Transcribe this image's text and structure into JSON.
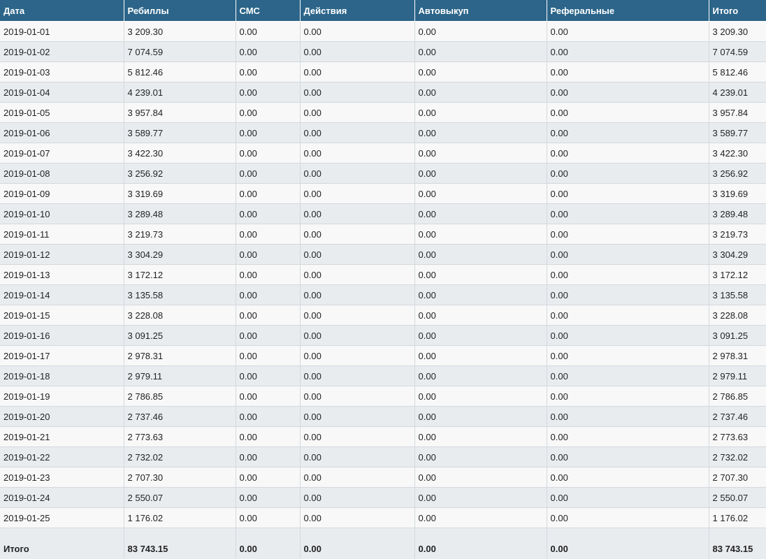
{
  "table": {
    "headers": [
      "Дата",
      "Ребиллы",
      "СМС",
      "Действия",
      "Автовыкуп",
      "Реферальные",
      "Итого"
    ],
    "rows": [
      [
        "2019-01-01",
        "3 209.30",
        "0.00",
        "0.00",
        "0.00",
        "0.00",
        "3 209.30"
      ],
      [
        "2019-01-02",
        "7 074.59",
        "0.00",
        "0.00",
        "0.00",
        "0.00",
        "7 074.59"
      ],
      [
        "2019-01-03",
        "5 812.46",
        "0.00",
        "0.00",
        "0.00",
        "0.00",
        "5 812.46"
      ],
      [
        "2019-01-04",
        "4 239.01",
        "0.00",
        "0.00",
        "0.00",
        "0.00",
        "4 239.01"
      ],
      [
        "2019-01-05",
        "3 957.84",
        "0.00",
        "0.00",
        "0.00",
        "0.00",
        "3 957.84"
      ],
      [
        "2019-01-06",
        "3 589.77",
        "0.00",
        "0.00",
        "0.00",
        "0.00",
        "3 589.77"
      ],
      [
        "2019-01-07",
        "3 422.30",
        "0.00",
        "0.00",
        "0.00",
        "0.00",
        "3 422.30"
      ],
      [
        "2019-01-08",
        "3 256.92",
        "0.00",
        "0.00",
        "0.00",
        "0.00",
        "3 256.92"
      ],
      [
        "2019-01-09",
        "3 319.69",
        "0.00",
        "0.00",
        "0.00",
        "0.00",
        "3 319.69"
      ],
      [
        "2019-01-10",
        "3 289.48",
        "0.00",
        "0.00",
        "0.00",
        "0.00",
        "3 289.48"
      ],
      [
        "2019-01-11",
        "3 219.73",
        "0.00",
        "0.00",
        "0.00",
        "0.00",
        "3 219.73"
      ],
      [
        "2019-01-12",
        "3 304.29",
        "0.00",
        "0.00",
        "0.00",
        "0.00",
        "3 304.29"
      ],
      [
        "2019-01-13",
        "3 172.12",
        "0.00",
        "0.00",
        "0.00",
        "0.00",
        "3 172.12"
      ],
      [
        "2019-01-14",
        "3 135.58",
        "0.00",
        "0.00",
        "0.00",
        "0.00",
        "3 135.58"
      ],
      [
        "2019-01-15",
        "3 228.08",
        "0.00",
        "0.00",
        "0.00",
        "0.00",
        "3 228.08"
      ],
      [
        "2019-01-16",
        "3 091.25",
        "0.00",
        "0.00",
        "0.00",
        "0.00",
        "3 091.25"
      ],
      [
        "2019-01-17",
        "2 978.31",
        "0.00",
        "0.00",
        "0.00",
        "0.00",
        "2 978.31"
      ],
      [
        "2019-01-18",
        "2 979.11",
        "0.00",
        "0.00",
        "0.00",
        "0.00",
        "2 979.11"
      ],
      [
        "2019-01-19",
        "2 786.85",
        "0.00",
        "0.00",
        "0.00",
        "0.00",
        "2 786.85"
      ],
      [
        "2019-01-20",
        "2 737.46",
        "0.00",
        "0.00",
        "0.00",
        "0.00",
        "2 737.46"
      ],
      [
        "2019-01-21",
        "2 773.63",
        "0.00",
        "0.00",
        "0.00",
        "0.00",
        "2 773.63"
      ],
      [
        "2019-01-22",
        "2 732.02",
        "0.00",
        "0.00",
        "0.00",
        "0.00",
        "2 732.02"
      ],
      [
        "2019-01-23",
        "2 707.30",
        "0.00",
        "0.00",
        "0.00",
        "0.00",
        "2 707.30"
      ],
      [
        "2019-01-24",
        "2 550.07",
        "0.00",
        "0.00",
        "0.00",
        "0.00",
        "2 550.07"
      ],
      [
        "2019-01-25",
        "1 176.02",
        "0.00",
        "0.00",
        "0.00",
        "0.00",
        "1 176.02"
      ]
    ],
    "totals": [
      "Итого",
      "83 743.15",
      "0.00",
      "0.00",
      "0.00",
      "0.00",
      "83 743.15"
    ]
  },
  "colors": {
    "header_bg": "#2c6589",
    "row_light": "#f8f8f8",
    "row_dark": "#e9ecef"
  }
}
